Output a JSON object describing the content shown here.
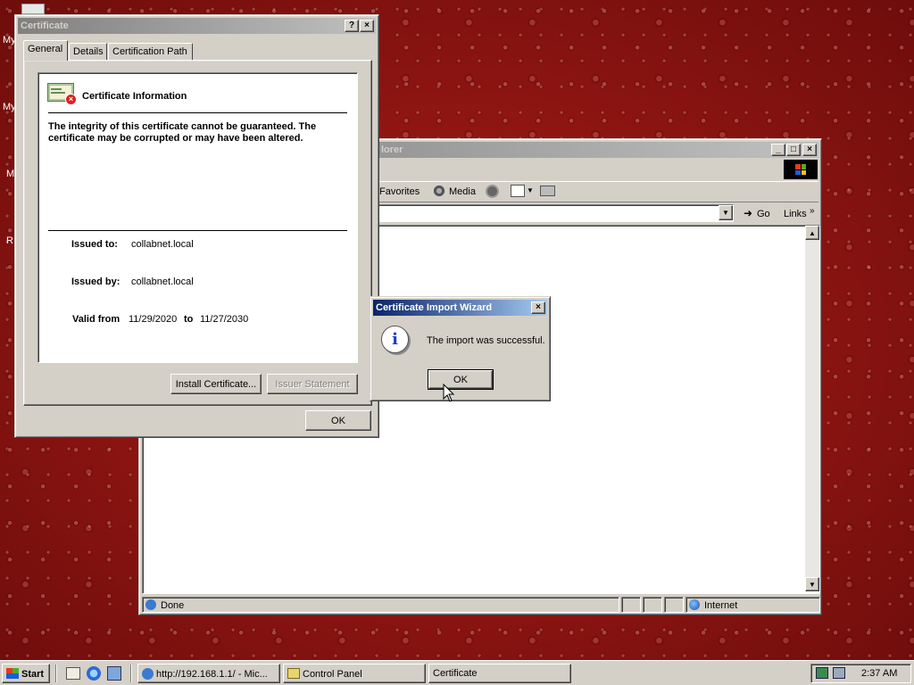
{
  "desktop": {
    "icon_labels": [
      "My",
      "My",
      "M",
      "R"
    ]
  },
  "ie_window": {
    "title": "lorer",
    "toolbar": {
      "favorites": "Favorites",
      "media": "Media"
    },
    "address": {
      "go": "Go",
      "links": "Links"
    },
    "status": {
      "text": "Done",
      "zone": "Internet"
    }
  },
  "cert_dialog": {
    "title": "Certificate",
    "help_btn": "?",
    "close_btn": "×",
    "tabs": [
      {
        "label": "General"
      },
      {
        "label": "Details"
      },
      {
        "label": "Certification Path"
      }
    ],
    "heading": "Certificate Information",
    "warning": "The integrity of this certificate cannot be guaranteed. The certificate may be corrupted or may have been altered.",
    "issued_to_label": "Issued to:",
    "issued_to": "collabnet.local",
    "issued_by_label": "Issued by:",
    "issued_by": "collabnet.local",
    "valid_from_label": "Valid from",
    "valid_from": "11/29/2020",
    "valid_to_label": "to",
    "valid_to": "11/27/2030",
    "install_btn": "Install Certificate...",
    "issuer_btn": "Issuer Statement",
    "ok_btn": "OK"
  },
  "wizard_dialog": {
    "title": "Certificate Import Wizard",
    "message": "The import was successful.",
    "ok_btn": "OK",
    "close_btn": "×"
  },
  "taskbar": {
    "start": "Start",
    "tasks": [
      {
        "label": "http://192.168.1.1/ - Mic..."
      },
      {
        "label": "Control Panel"
      },
      {
        "label": "Certificate"
      }
    ],
    "clock": "2:37 AM"
  }
}
